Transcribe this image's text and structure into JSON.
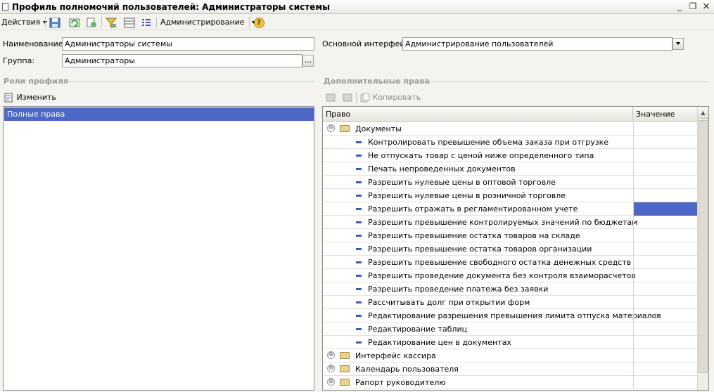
{
  "window": {
    "title": "Профиль полномочий пользователей: Администраторы системы",
    "minimize": "_",
    "restore": "❐",
    "close": "×"
  },
  "toolbar": {
    "actions_label": "Действия",
    "admin_label": "Администрирование",
    "help": "?"
  },
  "form": {
    "name_label": "Наименование:",
    "name_value": "Администраторы системы",
    "group_label": "Группа:",
    "group_value": "Администраторы",
    "group_button": "...",
    "interface_label": "Основной интерфейс:",
    "interface_value": "Администрирование пользователей"
  },
  "roles": {
    "section_title": "Роли профиля",
    "edit_label": "Изменить",
    "items": [
      "Полные права"
    ]
  },
  "rights": {
    "section_title": "Дополнительные права",
    "copy_label": "Копировать",
    "col_right": "Право",
    "col_value": "Значение",
    "group_documents": "Документы",
    "items": [
      "Контролировать превышение объема заказа при отгрузке",
      "Не отпускать товар с ценой ниже определенного типа",
      "Печать непроведенных документов",
      "Разрешить нулевые цены в оптовой торговле",
      "Разрешить нулевые цены в розничной торговле",
      "Разрешить отражать в регламентированном учете",
      "Разрешить превышение контролируемых значений по бюджетам",
      "Разрешить превышение остатка товаров на складе",
      "Разрешить превышение остатка товаров организации",
      "Разрешить превышение свободного остатка денежных средств",
      "Разрешить проведение документа без контроля взаиморасчетов",
      "Разрешить проведение платежа без заявки",
      "Рассчитывать долг при открытии форм",
      "Редактирование разрешения превышения лимита отпуска материалов",
      "Редактирование таблиц",
      "Редактирование цен в документах"
    ],
    "groups_collapsed": [
      "Интерфейс кассира",
      "Календарь пользователя",
      "Рапорт руководителю"
    ],
    "expander_open": "⊖",
    "expander_closed": "⊕"
  },
  "colors": {
    "selection": "#4c67c6",
    "background": "#f4f3ef"
  }
}
